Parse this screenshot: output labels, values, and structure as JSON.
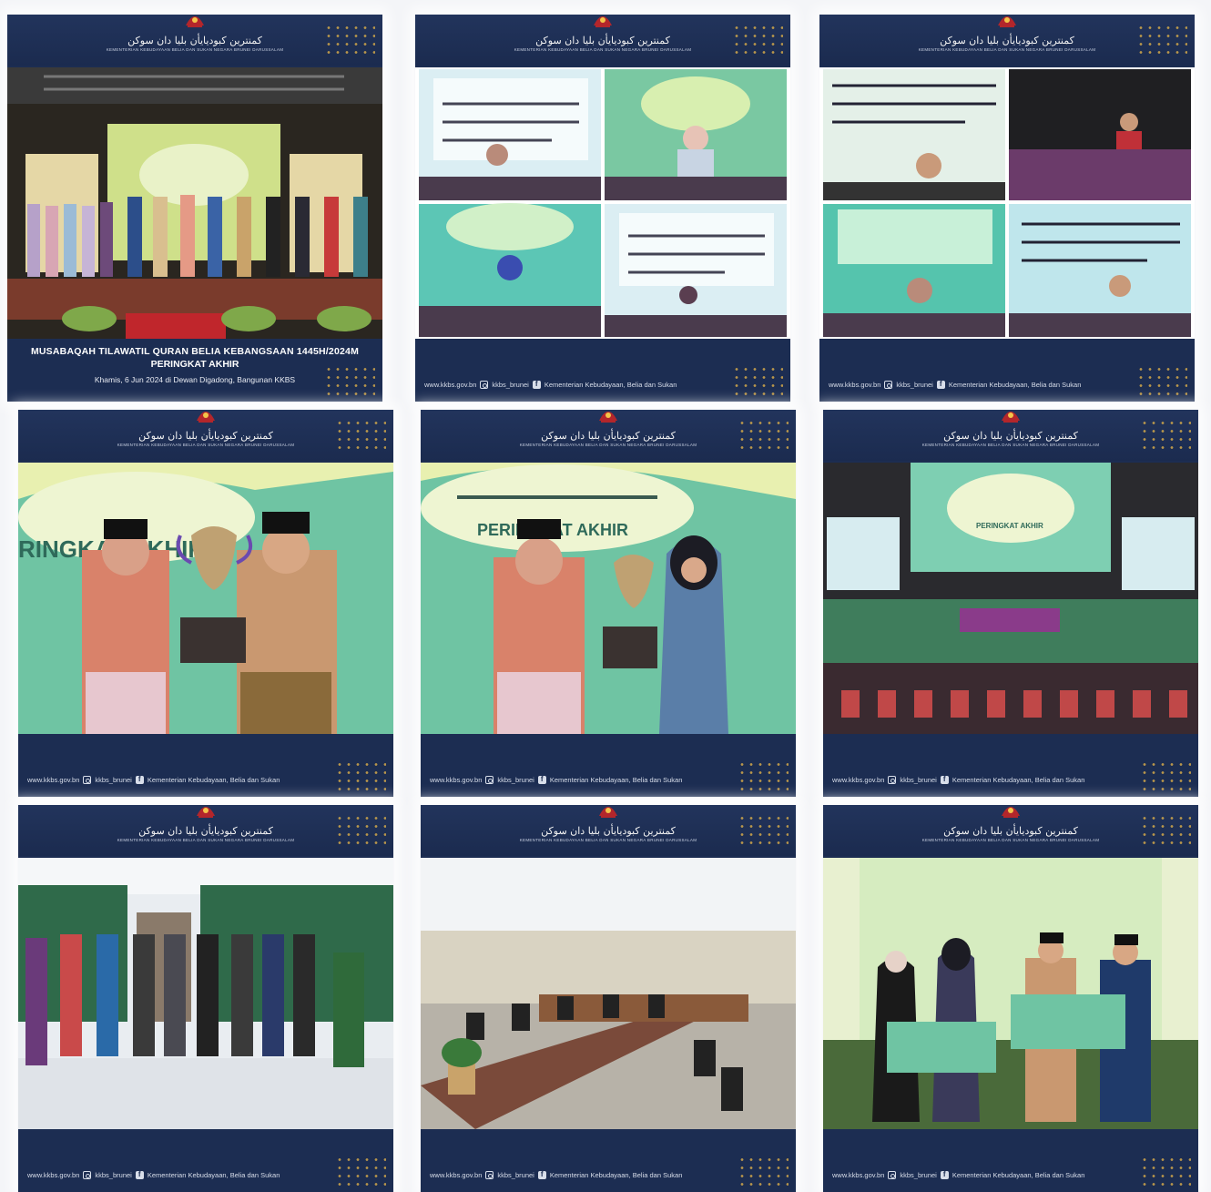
{
  "header": {
    "jawi_title": "كمنترين كبوديايأن بليا دان سوكن",
    "ministry_subtitle": "KEMENTERIAN KEBUDAYAAN BELIA DAN SUKAN NEGARA BRUNEI DARUSSALAM"
  },
  "footer": {
    "website": "www.kkbs.gov.bn",
    "instagram": "kkbs_brunei",
    "facebook": "Kementerian Kebudayaan, Belia dan Sukan"
  },
  "event": {
    "title_line1": "MUSABAQAH TILAWATIL QURAN BELIA KEBANGSAAN 1445H/2024M",
    "title_line2": "PERINGKAT AKHIR",
    "date_venue": "Khamis, 6 Jun 2024 di Dewan Digadong, Bangunan KKBS"
  },
  "backdrop": {
    "peringkat_akhir": "PERINGKAT AKHIR",
    "ringkat_akhir_cropped": "RINGKAT AKHIR"
  },
  "colors": {
    "card_navy": "#1c2d52",
    "gold_dots": "#c9a24a",
    "crest_red": "#b3262b",
    "backdrop_green": "#6fc4a3",
    "backdrop_yellow": "#e8f0b0"
  }
}
